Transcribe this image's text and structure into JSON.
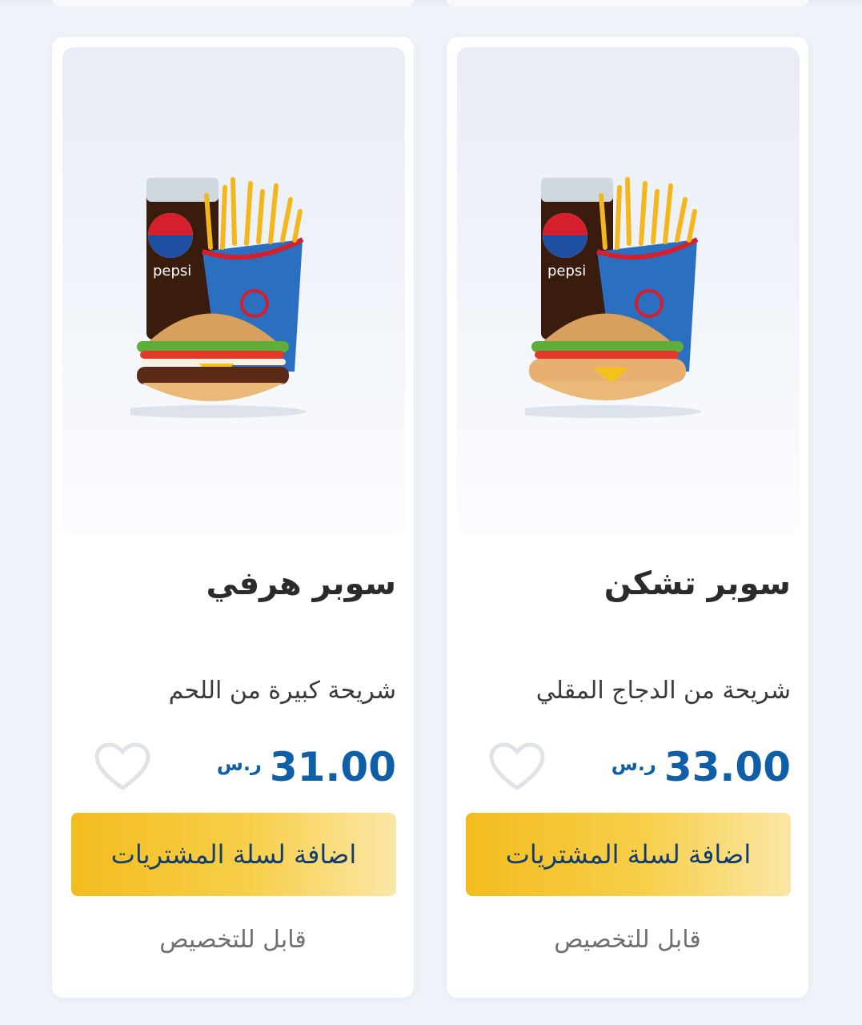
{
  "products": [
    {
      "title": "سوبر تشكن",
      "description": "شريحة من الدجاج المقلي",
      "price": "33.00",
      "currency": "ر.س",
      "add_to_cart_label": "اضافة لسلة المشتريات",
      "customizable_label": "قابل للتخصيص",
      "image_icon": "chicken-burger-meal-image"
    },
    {
      "title": "سوبر هرفي",
      "description": "شريحة كبيرة من اللحم",
      "price": "31.00",
      "currency": "ر.س",
      "add_to_cart_label": "اضافة لسلة المشتريات",
      "customizable_label": "قابل للتخصيص",
      "image_icon": "beef-burger-meal-image"
    }
  ],
  "colors": {
    "accent_blue": "#0e5ea8",
    "button_yellow": "#f3bc1e",
    "background": "#eef3f9"
  }
}
